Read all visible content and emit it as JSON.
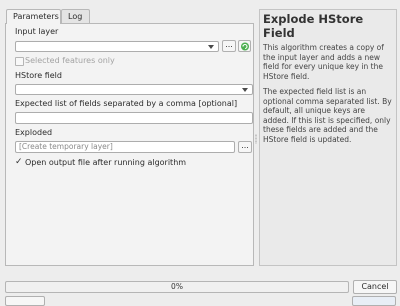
{
  "tabs": [
    {
      "label": "Parameters",
      "active": true
    },
    {
      "label": "Log",
      "active": false
    }
  ],
  "form": {
    "input_layer_label": "Input layer",
    "input_layer_value": "",
    "selected_features_label": "Selected features only",
    "selected_features_checked": false,
    "hstore_field_label": "HStore field",
    "hstore_field_value": "",
    "expected_fields_label": "Expected list of fields separated by a comma [optional]",
    "expected_fields_value": "",
    "exploded_label": "Exploded",
    "exploded_placeholder": "[Create temporary layer]",
    "browse_label": "...",
    "open_output_label": "Open output file after running algorithm",
    "open_output_checked": true
  },
  "help": {
    "title": "Explode HStore Field",
    "paragraphs": [
      "This algorithm creates a copy of the input layer and adds a new field for every unique key in the HStore field.",
      "The expected field list is an optional comma separated list. By default, all unique keys are added. If this list is specified, only these fields are added and the HStore field is updated."
    ]
  },
  "footer": {
    "progress_text": "0%",
    "progress_value": 0,
    "cancel_label": "Cancel"
  },
  "colors": {
    "iterate_icon": "#4caf50"
  },
  "icons": {
    "iterate": "iterate-icon",
    "dropdown": "chevron-down-icon",
    "check": "check-icon"
  }
}
